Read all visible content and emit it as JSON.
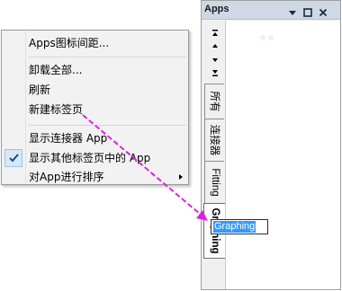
{
  "menu": {
    "items": [
      {
        "label": "Apps图标间距..."
      },
      {
        "label": "卸载全部..."
      },
      {
        "label": "刷新"
      },
      {
        "label": "新建标签页"
      },
      {
        "label": "显示连接器 App"
      },
      {
        "label": "显示其他标签页中的 App",
        "checked": true
      },
      {
        "label": "对App进行排序",
        "submenu": true
      }
    ]
  },
  "panel": {
    "title": "Apps",
    "title_buttons": [
      "menu-arrow-icon",
      "restore-icon",
      "close-icon"
    ],
    "tabs": [
      {
        "label": "所有"
      },
      {
        "label": "连接器"
      },
      {
        "label": "Fitting"
      },
      {
        "label": "Graphing",
        "active": true
      }
    ],
    "rename_value": "Graphing"
  },
  "colors": {
    "annotation_arrow": "#e020e0",
    "selection": "#3399ff",
    "titlebar": "#cfd8e4"
  }
}
